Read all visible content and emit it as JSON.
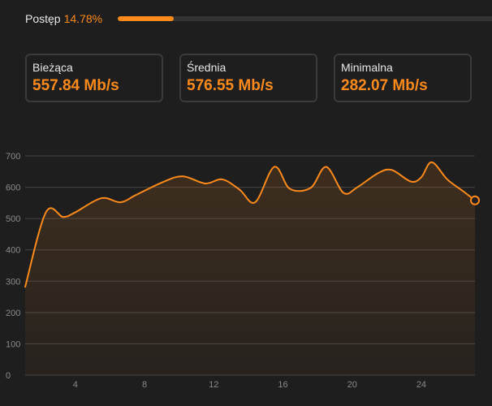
{
  "progress": {
    "label": "Postęp",
    "value_text": "14.78%",
    "fraction": 0.1478
  },
  "stats": [
    {
      "label": "Bieżąca",
      "value": "557.84 Mb/s"
    },
    {
      "label": "Średnia",
      "value": "576.55 Mb/s"
    },
    {
      "label": "Minimalna",
      "value": "282.07 Mb/s"
    }
  ],
  "colors": {
    "accent": "#ff8a1c",
    "background": "#1e1e1e",
    "grid": "#444444"
  },
  "chart_data": {
    "type": "area",
    "grid": true,
    "xlim": [
      1.1,
      27.1
    ],
    "ylim": [
      0,
      700
    ],
    "x_ticks": [
      4,
      8,
      12,
      16,
      20,
      24
    ],
    "y_ticks": [
      0,
      100,
      200,
      300,
      400,
      500,
      600,
      700
    ],
    "x": [
      1.1,
      2.3,
      3.3,
      4.0,
      5.5,
      6.6,
      7.5,
      9.0,
      10.2,
      11.5,
      12.5,
      13.5,
      14.4,
      15.5,
      16.4,
      17.6,
      18.5,
      19.5,
      20.3,
      21.5,
      22.3,
      23.4,
      24.0,
      24.6,
      25.5,
      26.4,
      27.1
    ],
    "values": [
      282,
      520,
      505,
      520,
      565,
      552,
      575,
      615,
      635,
      612,
      625,
      592,
      552,
      665,
      595,
      598,
      665,
      582,
      600,
      645,
      655,
      618,
      632,
      680,
      625,
      588,
      558
    ]
  }
}
